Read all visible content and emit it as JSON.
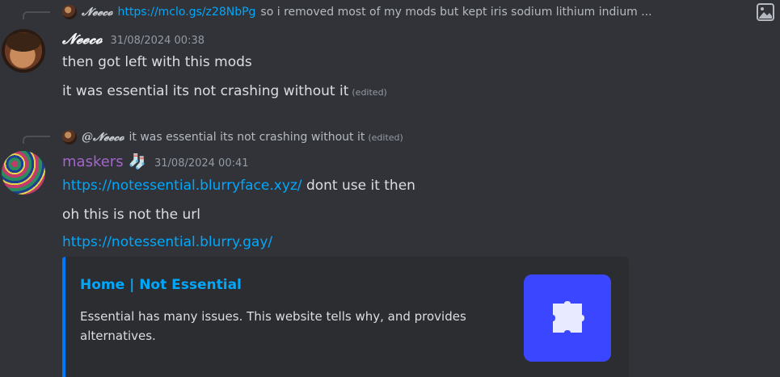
{
  "reply1": {
    "author": "𝓝𝓮𝓮𝓬𝓸",
    "link": "https://mclo.gs/z28NbPg",
    "text": "so i removed most of my mods but kept iris sodium lithium indium ..."
  },
  "message1": {
    "author": "𝓝𝓮𝓮𝓬𝓸",
    "timestamp": "31/08/2024 00:38",
    "lines": [
      "then got left with this mods",
      "it was essential its not crashing without it"
    ],
    "edited": "(edited)"
  },
  "reply2": {
    "author": "@𝓝𝓮𝓮𝓬𝓸",
    "text": "it was essential its not crashing without it",
    "edited": "(edited)"
  },
  "message2": {
    "author": "maskers",
    "badge": "🧦",
    "timestamp": "31/08/2024 00:41",
    "link1": "https://notessential.blurryface.xyz/",
    "line1_rest": "dont use it then",
    "line2": "oh this is not the url",
    "link2": "https://notessential.blurry.gay/"
  },
  "embed": {
    "title": "Home | Not Essential",
    "description": "Essential has many issues. This website tells why, and provides alternatives.",
    "accent_color": "#0077ff",
    "thumbnail_color": "#3a46ff",
    "thumbnail_icon": "puzzle-icon"
  },
  "icons": {
    "attachment": "image-icon"
  }
}
